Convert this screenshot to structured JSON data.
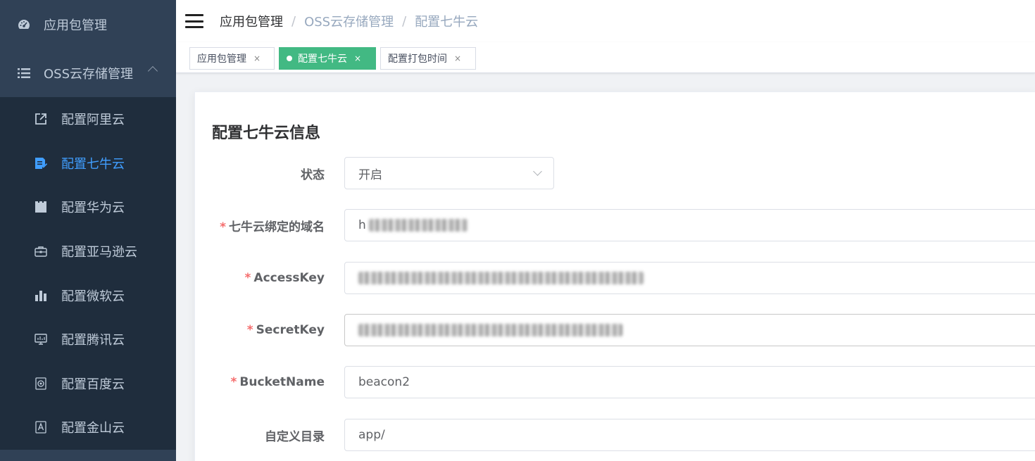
{
  "sidebar": {
    "top_item": {
      "label": "应用包管理",
      "icon": "dashboard-icon"
    },
    "group": {
      "label": "OSS云存储管理",
      "icon": "list-icon",
      "expanded": true
    },
    "sub_items": [
      {
        "label": "配置阿里云",
        "icon": "external-link-icon",
        "active": false
      },
      {
        "label": "配置七牛云",
        "icon": "document-edit-icon",
        "active": true
      },
      {
        "label": "配置华为云",
        "icon": "clapperboard-icon",
        "active": false
      },
      {
        "label": "配置亚马逊云",
        "icon": "briefcase-icon",
        "active": false
      },
      {
        "label": "配置微软云",
        "icon": "bar-chart-icon",
        "active": false
      },
      {
        "label": "配置腾讯云",
        "icon": "monitor-icon",
        "active": false
      },
      {
        "label": "配置百度云",
        "icon": "target-icon",
        "active": false
      },
      {
        "label": "配置金山云",
        "icon": "badge-icon",
        "active": false
      }
    ],
    "colors": {
      "bg": "#304156",
      "submenu_bg": "#1f2d3d",
      "text": "#bfcbd9",
      "active": "#409eff"
    }
  },
  "breadcrumb": {
    "items": [
      "应用包管理",
      "OSS云存储管理",
      "配置七牛云"
    ],
    "separator": "/"
  },
  "tags": [
    {
      "label": "应用包管理",
      "close": "×",
      "active": false
    },
    {
      "label": "配置七牛云",
      "close": "×",
      "active": true
    },
    {
      "label": "配置打包时间",
      "close": "×",
      "active": false
    }
  ],
  "form": {
    "title": "配置七牛云信息",
    "fields": [
      {
        "label": "状态",
        "required": false,
        "value": "开启",
        "type": "select"
      },
      {
        "label": "七牛云绑定的域名",
        "required": true,
        "value": "h",
        "obscured": true
      },
      {
        "label": "AccessKey",
        "required": true,
        "value": "",
        "obscured": true
      },
      {
        "label": "SecretKey",
        "required": true,
        "value": "",
        "obscured": true
      },
      {
        "label": "BucketName",
        "required": true,
        "value": "beacon2"
      },
      {
        "label": "自定义目录",
        "required": false,
        "value": "app/"
      }
    ],
    "required_mark": "*"
  },
  "accent": {
    "tag_active": "#42b983",
    "required": "#f56c6c"
  }
}
